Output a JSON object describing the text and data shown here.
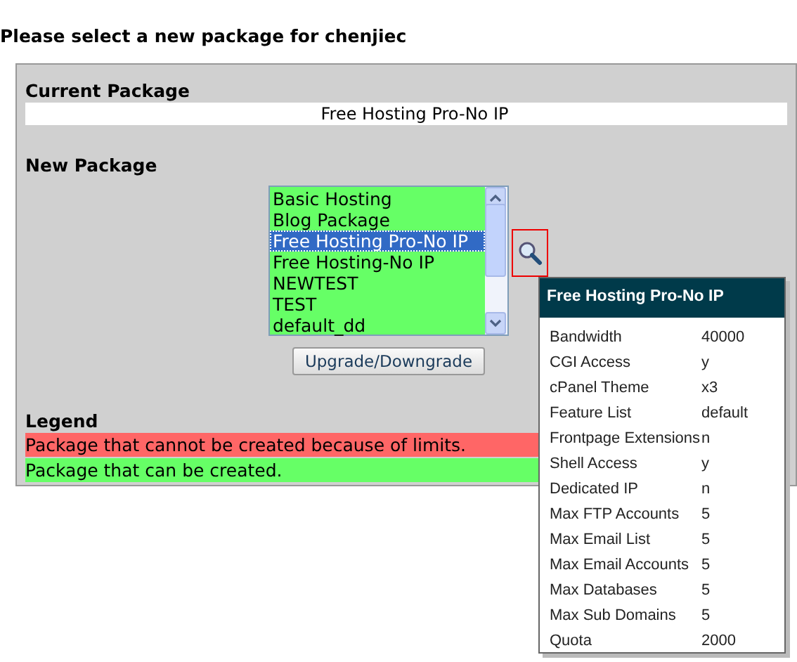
{
  "heading": "Please select a new package for chenjiec",
  "current_package": {
    "label": "Current Package",
    "value": "Free Hosting Pro-No IP"
  },
  "new_package": {
    "label": "New Package",
    "options": [
      {
        "label": "Basic Hosting",
        "selected": false
      },
      {
        "label": "Blog Package",
        "selected": false
      },
      {
        "label": "Free Hosting Pro-No IP",
        "selected": true
      },
      {
        "label": "Free Hosting-No IP",
        "selected": false
      },
      {
        "label": "NEWTEST",
        "selected": false
      },
      {
        "label": "TEST",
        "selected": false
      },
      {
        "label": "default_dd",
        "selected": false
      }
    ],
    "button": "Upgrade/Downgrade"
  },
  "legend": {
    "label": "Legend",
    "items": [
      {
        "text": "Package that cannot be created because of limits.",
        "color": "#ff6666"
      },
      {
        "text": "Package that can be created.",
        "color": "#66ff66"
      }
    ]
  },
  "details_popup": {
    "title": "Free Hosting Pro-No IP",
    "rows": [
      {
        "name": "Bandwidth",
        "value": "40000"
      },
      {
        "name": "CGI Access",
        "value": "y"
      },
      {
        "name": "cPanel Theme",
        "value": "x3"
      },
      {
        "name": "Feature List",
        "value": "default"
      },
      {
        "name": "Frontpage Extensions",
        "value": "n"
      },
      {
        "name": "Shell Access",
        "value": "y"
      },
      {
        "name": "Dedicated IP",
        "value": "n"
      },
      {
        "name": "Max FTP Accounts",
        "value": "5"
      },
      {
        "name": "Max Email List",
        "value": "5"
      },
      {
        "name": "Max Email Accounts",
        "value": "5"
      },
      {
        "name": "Max Databases",
        "value": "5"
      },
      {
        "name": "Max Sub Domains",
        "value": "5"
      },
      {
        "name": "Quota",
        "value": "2000"
      }
    ]
  }
}
